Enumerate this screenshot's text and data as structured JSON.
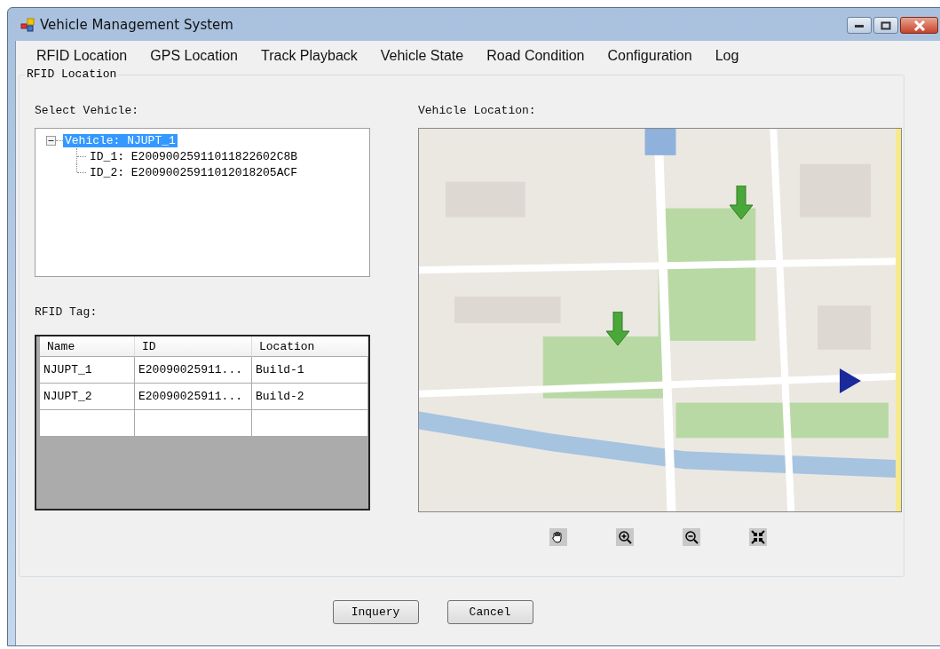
{
  "window": {
    "title": "Vehicle Management System"
  },
  "menu": [
    "RFID Location",
    "GPS Location",
    "Track Playback",
    "Vehicle State",
    "Road Condition",
    "Configuration",
    "Log"
  ],
  "group": {
    "title": "RFID Location"
  },
  "select_vehicle": {
    "label": "Select Vehicle:",
    "tree": [
      {
        "label": "Vehicle: NJUPT_1",
        "selected": true,
        "expanded": true,
        "children": [
          {
            "label": "ID_1: E20090025911011822602C8B",
            "selected": false
          },
          {
            "label": "ID_2: E20090025911012018205ACF",
            "selected": false
          }
        ]
      }
    ]
  },
  "rfid_tag": {
    "label": "RFID Tag:",
    "columns": [
      "Name",
      "ID",
      "Location"
    ],
    "rows": [
      [
        "NJUPT_1",
        "E20090025911...",
        "Build-1"
      ],
      [
        "NJUPT_2",
        "E20090025911...",
        "Build-2"
      ]
    ]
  },
  "map": {
    "label": "Vehicle Location:",
    "kind": "picture"
  },
  "buttons": [
    "Inquery",
    "Cancel"
  ]
}
